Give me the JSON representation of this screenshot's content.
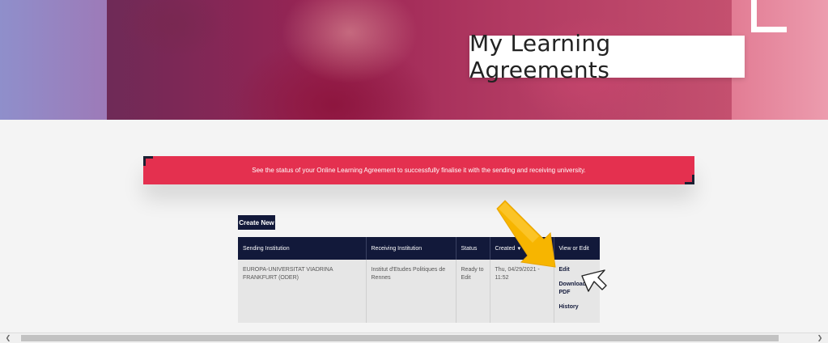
{
  "hero": {
    "title": "My Learning Agreements"
  },
  "banner": {
    "text": "See the status of your Online Learning Agreement to successfully finalise it with the sending and receiving university."
  },
  "toolbar": {
    "create_label": "Create New"
  },
  "table": {
    "headers": {
      "sending": "Sending Institution",
      "receiving": "Receiving Institution",
      "status": "Status",
      "created": "Created",
      "created_sort_glyph": "▼",
      "view_or_edit": "View or Edit"
    },
    "rows": [
      {
        "sending": "EUROPA-UNIVERSITAT VIADRINA FRANKFURT (ODER)",
        "receiving": "Institut d'Etudes Politiques de Rennes",
        "status": "Ready to Edit",
        "created": "Thu, 04/29/2021 - 11:52",
        "actions": {
          "edit": "Edit",
          "download": "Download PDF",
          "history": "History"
        }
      }
    ]
  },
  "scrollbar": {
    "left_glyph": "❮",
    "right_glyph": "❯"
  },
  "icons": {
    "annotation": "arrow-annotation-icon",
    "cursor": "mouse-cursor-icon"
  },
  "colors": {
    "navy": "#12193a",
    "banner_red": "#e4304f",
    "arrow_yellow": "#f7b500"
  }
}
